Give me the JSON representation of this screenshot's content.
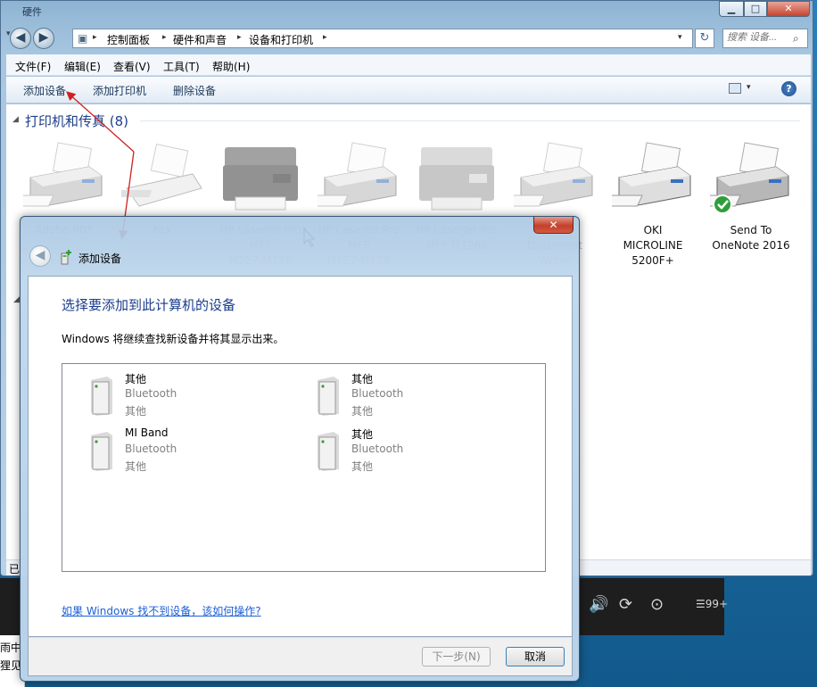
{
  "window": {
    "title": "硬件",
    "caption_minimize": "▁",
    "caption_maximize": "□",
    "caption_close": "✕"
  },
  "nav": {
    "back": "◀",
    "forward": "▶",
    "history": "▾",
    "breadcrumbs": [
      "控制面板",
      "硬件和声音",
      "设备和打印机"
    ],
    "separator": "▸",
    "address_dropdown": "▾",
    "refresh": "↻",
    "search_placeholder": "搜索 设备..."
  },
  "menubar": [
    "文件(F)",
    "编辑(E)",
    "查看(V)",
    "工具(T)",
    "帮助(H)"
  ],
  "toolbar": {
    "add_device": "添加设备",
    "add_printer": "添加打印机",
    "remove_device": "删除设备",
    "view_dropdown": "▾",
    "help": "?"
  },
  "printers_group": {
    "caret": "◢",
    "title": "打印机和传真 (8)",
    "items": [
      {
        "lines": [
          "Adobe PDF",
          "",
          ""
        ],
        "kind": "inkjet",
        "ghost": true
      },
      {
        "lines": [
          "Fax",
          "",
          ""
        ],
        "kind": "fax",
        "ghost": true
      },
      {
        "lines": [
          "HP LaserJet Pro",
          "MFP",
          "M127-M128"
        ],
        "kind": "mfp",
        "ghost": true
      },
      {
        "lines": [
          "HP LaserJet Pro",
          "MFP",
          "M127-M128"
        ],
        "kind": "inkjet",
        "ghost": true
      },
      {
        "lines": [
          "HP LaserJet Pro",
          "MFP M126a",
          ""
        ],
        "kind": "mfp-gray",
        "ghost": true
      },
      {
        "lines": [
          "XPS",
          "Document",
          "Writer"
        ],
        "kind": "inkjet",
        "ghost": true
      },
      {
        "lines": [
          "OKI",
          "MICROLINE",
          "5200F+"
        ],
        "kind": "inkjet-light",
        "ghost": false
      },
      {
        "lines": [
          "Send To",
          "OneNote 2016",
          ""
        ],
        "kind": "inkjet-default",
        "ghost": false
      }
    ]
  },
  "status_bar": "已",
  "media_bar": {
    "volume": "🔊",
    "repeat": "⟳",
    "more": "⊙",
    "queue_count": "☰99+"
  },
  "background_doc": [
    "雨中",
    "狸见"
  ],
  "dialog": {
    "close": "✕",
    "back": "◀",
    "title": "添加设备",
    "heading": "选择要添加到此计算机的设备",
    "description": "Windows 将继续查找新设备并将其显示出来。",
    "devices": [
      {
        "name": "其他",
        "connection": "Bluetooth",
        "type": "其他"
      },
      {
        "name": "其他",
        "connection": "Bluetooth",
        "type": "其他"
      },
      {
        "name": "MI Band",
        "connection": "Bluetooth",
        "type": "其他"
      },
      {
        "name": "其他",
        "connection": "Bluetooth",
        "type": "其他"
      }
    ],
    "help_link": "如果 Windows 找不到设备，该如何操作?",
    "next_button": "下一步(N)",
    "cancel_button": "取消"
  },
  "colors": {
    "accent_red": "#d02121",
    "heading_blue": "#1a3b8c",
    "link_blue": "#1c5fd6"
  }
}
